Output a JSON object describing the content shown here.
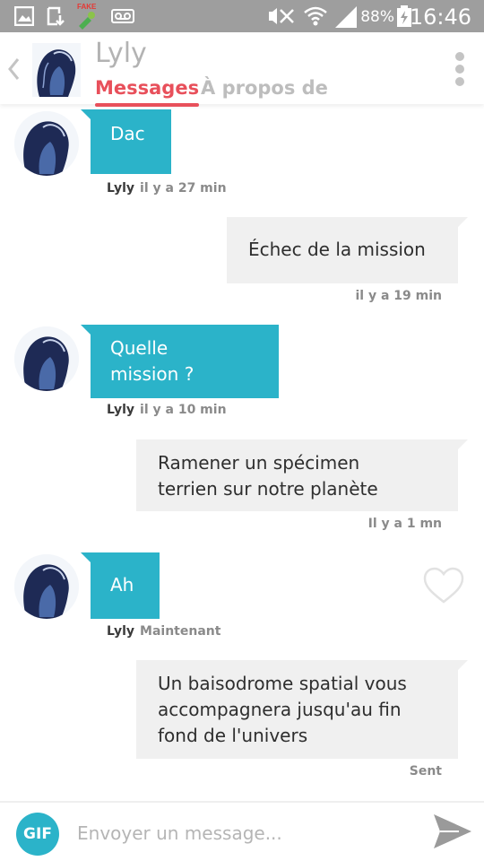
{
  "status_bar": {
    "fake_badge": "FAKE",
    "battery": "88%",
    "time": "16:46"
  },
  "header": {
    "contact_name": "Lyly",
    "tabs": [
      {
        "label": "Messages",
        "active": true
      },
      {
        "label": "À propos de",
        "active": false
      }
    ]
  },
  "messages": [
    {
      "direction": "in",
      "text": "Dac",
      "sender": "Lyly",
      "time": "il y a 27 min"
    },
    {
      "direction": "out",
      "text": "Échec de la mission",
      "time": "il y a 19 min"
    },
    {
      "direction": "in",
      "lines": [
        "Quelle",
        "mission ?"
      ],
      "sender": "Lyly",
      "time": "il y a 10 min"
    },
    {
      "direction": "out",
      "lines": [
        "Ramener un spécimen",
        "terrien sur notre planète"
      ],
      "time": "Il y a 1 mn"
    },
    {
      "direction": "in",
      "text": "Ah",
      "sender": "Lyly",
      "time": "Maintenant"
    },
    {
      "direction": "out",
      "lines": [
        "Un baisodrome spatial vous",
        "accompagnera jusqu'au fin",
        "fond de l'univers"
      ],
      "time": "Sent"
    }
  ],
  "composer": {
    "gif_label": "GIF",
    "placeholder": "Envoyer un message..."
  },
  "colors": {
    "accent": "#e8505b",
    "incoming_bubble": "#2bb3c9",
    "outgoing_bubble": "#f0f0f0",
    "status_bar": "#9e9e9e"
  },
  "icons": [
    "gallery-icon",
    "download-icon",
    "fake-gps-icon",
    "voicemail-icon",
    "mute-icon",
    "wifi-icon",
    "signal-icon",
    "battery-charging-icon",
    "back-chevron-icon",
    "overflow-menu-icon",
    "heart-icon",
    "send-icon"
  ]
}
